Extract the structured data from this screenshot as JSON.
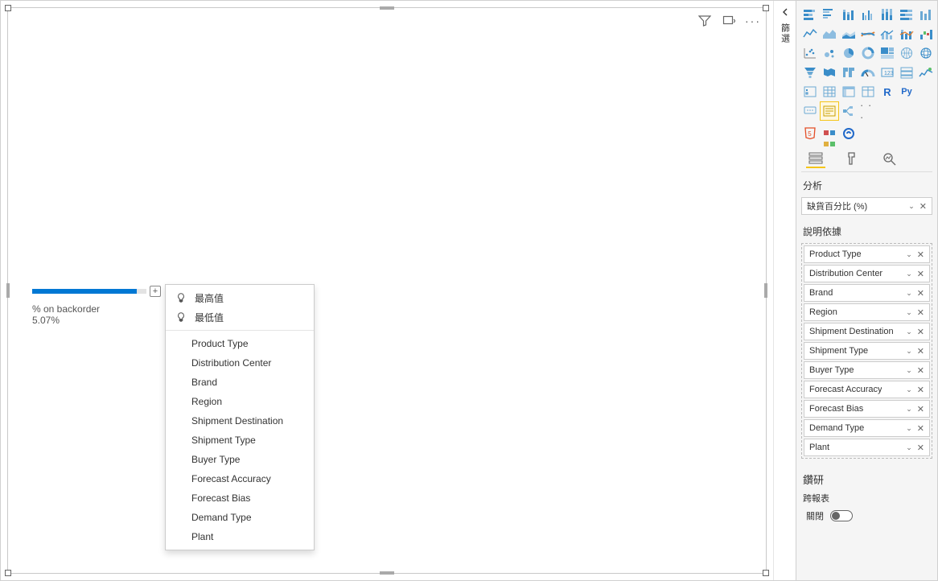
{
  "canvas": {
    "kpi_title": "% on backorder",
    "kpi_value": "5.07%"
  },
  "popup": {
    "highest": "最高值",
    "lowest": "最低值",
    "fields": [
      "Product Type",
      "Distribution Center",
      "Brand",
      "Region",
      "Shipment Destination",
      "Shipment Type",
      "Buyer Type",
      "Forecast Accuracy",
      "Forecast Bias",
      "Demand Type",
      "Plant"
    ]
  },
  "filters_collapsed_label": "篩選",
  "viz": {
    "section_analysis": "分析",
    "analyze_field": "缺貨百分比 (%)",
    "section_explain_by": "說明依據",
    "explain_fields": [
      "Product Type",
      "Distribution Center",
      "Brand",
      "Region",
      "Shipment Destination",
      "Shipment Type",
      "Buyer Type",
      "Forecast Accuracy",
      "Forecast Bias",
      "Demand Type",
      "Plant"
    ],
    "drill_header": "鑽研",
    "drill_cross_report": "跨報表",
    "toggle_off": "關閉"
  },
  "viz_icons": [
    "bar-stacked",
    "bar-clustered",
    "col-stacked",
    "col-clustered",
    "col-100",
    "bar-100",
    "col-grouped",
    "line",
    "area",
    "area-stacked",
    "ribbon",
    "line-col",
    "line-col-stacked",
    "waterfall",
    "scatter",
    "bubble",
    "pie",
    "donut",
    "treemap",
    "map",
    "globe",
    "funnel",
    "filled-map",
    "shape-map",
    "gauge",
    "card",
    "multicard",
    "kpi",
    "slicer",
    "table",
    "matrix",
    "key-influencers",
    "r-visual",
    "py-visual",
    "",
    "qa",
    "narrative",
    "more-visuals",
    "",
    "",
    "",
    ""
  ],
  "r_label": "R",
  "py_label": "Py",
  "more_dots": "· · ·"
}
